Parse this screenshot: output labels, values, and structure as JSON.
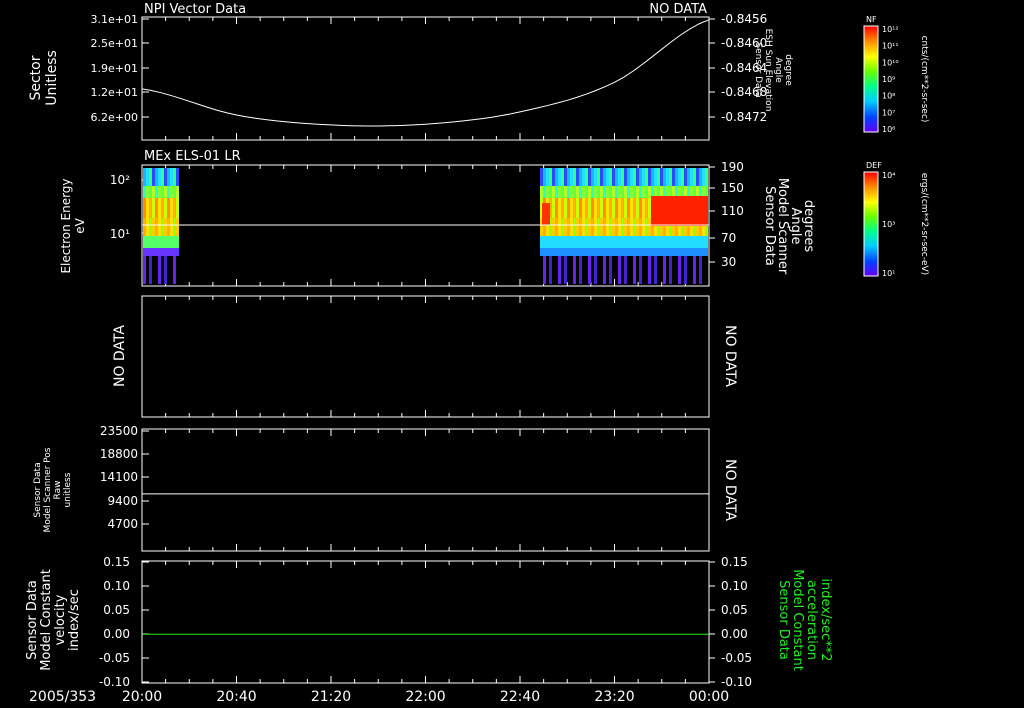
{
  "date_label": "2005/353",
  "x_ticks": [
    "20:00",
    "20:40",
    "21:20",
    "22:00",
    "22:40",
    "23:20",
    "00:00"
  ],
  "panels": [
    {
      "title_left": "NPI Vector Data",
      "title_right": "NO DATA",
      "ylabel": [
        "Sector",
        "Unitless"
      ],
      "left_ticks": [
        "3.1e+01",
        "2.5e+01",
        "1.9e+01",
        "1.2e+01",
        "6.2e+00"
      ],
      "right_ticks": [
        "-0.8456",
        "-0.8460",
        "-0.8464",
        "-0.8468",
        "-0.8472"
      ],
      "right_label": [
        "Sensor Data",
        "ESH Sun Elevation",
        "Angle",
        "degree"
      ]
    },
    {
      "title_left": "MEx ELS-01 LR",
      "ylabel": [
        "Electron Energy",
        "eV"
      ],
      "left_ticks": [
        "10²",
        "10¹"
      ],
      "right_ticks": [
        "190",
        "150",
        "110",
        "70",
        "30"
      ],
      "right_label": [
        "Sensor Data",
        "Model Scanner",
        "Angle",
        "degrees"
      ]
    },
    {
      "left_text": "NO DATA",
      "right_text": "NO DATA"
    },
    {
      "left_ticks": [
        "23500",
        "18800",
        "14100",
        "9400",
        "4700"
      ],
      "ylabel": [
        "Sensor Data",
        "Model Scanner Pos",
        "Raw",
        "unitless"
      ],
      "right_text": "NO DATA"
    },
    {
      "left_ticks": [
        "0.15",
        "0.10",
        "0.05",
        "0.00",
        "-0.05",
        "-0.10"
      ],
      "right_ticks": [
        "0.15",
        "0.10",
        "0.05",
        "0.00",
        "-0.05",
        "-0.10"
      ],
      "ylabel": [
        "Sensor Data",
        "Model Constant",
        "velocity",
        "index/sec"
      ],
      "right_label": [
        "Sensor Data",
        "Model Constant",
        "acceleration",
        "index/sec**2"
      ]
    }
  ],
  "colorbars": [
    {
      "tag": "NF",
      "unit": "cnts/(cm**2-sr-sec)",
      "ticks": [
        "10¹²",
        "10¹¹",
        "10¹⁰",
        "10⁹",
        "10⁸",
        "10⁷",
        "10⁶"
      ]
    },
    {
      "tag": "DEF",
      "unit": "ergs/(cm**2-sr-sec-eV)",
      "ticks": [
        "10⁴",
        "10³",
        "10¹"
      ]
    }
  ],
  "chart_data": [
    {
      "type": "line",
      "title": "NPI Vector Data",
      "ylabel": "Sector Unitless",
      "x": [
        "20:00",
        "20:40",
        "21:20",
        "22:00",
        "22:40",
        "23:20",
        "00:00"
      ],
      "series": [
        {
          "values": [
            12.8,
            6.0,
            3.4,
            3.6,
            6.8,
            14.5,
            30.8
          ]
        }
      ],
      "ylim": [
        0,
        31
      ]
    },
    {
      "type": "heatmap",
      "title": "MEx ELS-01 LR",
      "ylabel": "Electron Energy eV",
      "data_intervals": [
        [
          "20:00",
          "20:23"
        ],
        [
          "22:45",
          "00:00"
        ]
      ]
    },
    {
      "type": "line",
      "ylabel": "Sensor Data Model Scanner Pos Raw unitless",
      "series": [
        {
          "values": [
            11000,
            11000
          ]
        }
      ],
      "ylim": [
        0,
        23500
      ]
    },
    {
      "type": "line",
      "ylabel": "Sensor Data Model Constant velocity index/sec",
      "series": [
        {
          "values": [
            0,
            0
          ]
        }
      ],
      "ylim": [
        -0.1,
        0.15
      ]
    }
  ]
}
